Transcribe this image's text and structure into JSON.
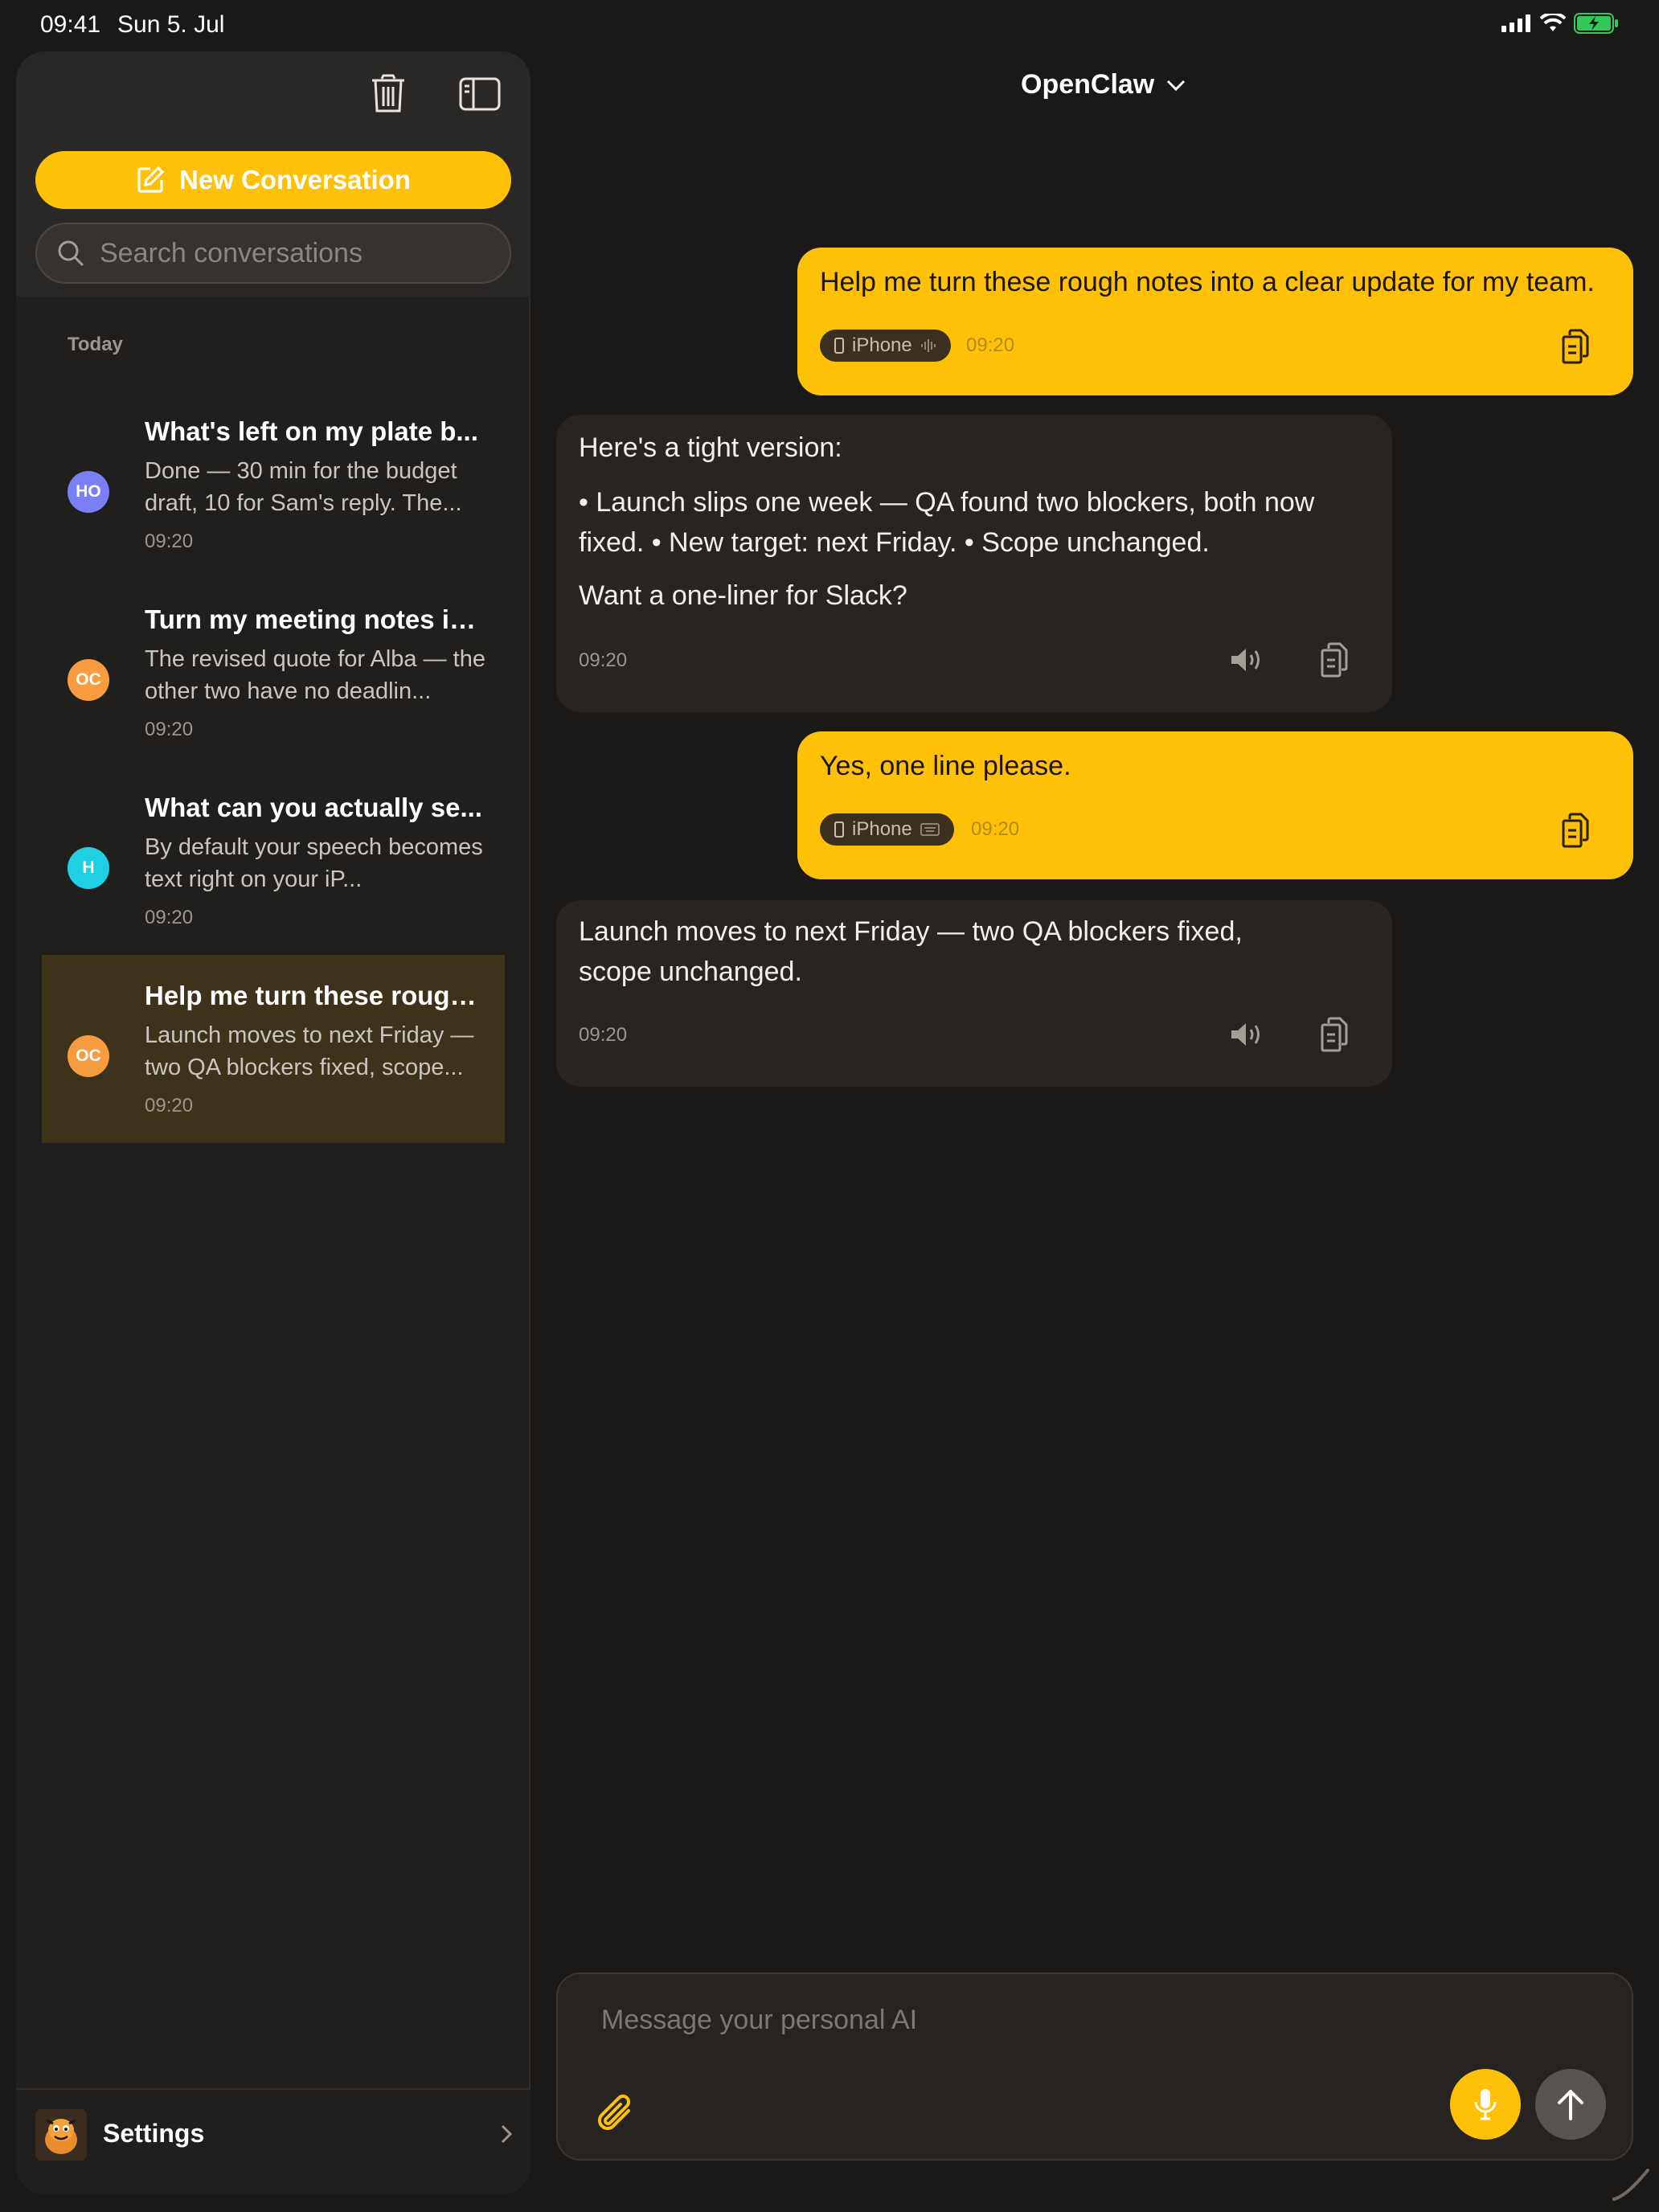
{
  "status_bar": {
    "time": "09:41",
    "date": "Sun 5. Jul"
  },
  "sidebar": {
    "new_conversation_label": "New Conversation",
    "search_placeholder": "Search conversations",
    "section_label": "Today",
    "conversations": [
      {
        "initials": "HO",
        "avatar_color": "#7b7ff5",
        "title": "What's left on my plate b...",
        "preview": "Done — 30 min for the budget draft, 10 for Sam's reply. The...",
        "time": "09:20",
        "active": false
      },
      {
        "initials": "OC",
        "avatar_color": "#f79c3f",
        "title": "Turn my meeting notes in...",
        "preview": "The revised quote for Alba — the other two have no deadlin...",
        "time": "09:20",
        "active": false
      },
      {
        "initials": "H",
        "avatar_color": "#1fcfe3",
        "title": "What can you actually se...",
        "preview": "By default your speech becomes text right on your iP...",
        "time": "09:20",
        "active": false
      },
      {
        "initials": "OC",
        "avatar_color": "#f79c3f",
        "title": "Help me turn these rough...",
        "preview": "Launch moves to next Friday — two QA blockers fixed, scope...",
        "time": "09:20",
        "active": true
      }
    ],
    "settings_label": "Settings"
  },
  "header": {
    "title": "OpenClaw"
  },
  "messages": [
    {
      "role": "user",
      "text": "Help me turn these rough notes into a clear update for my team.",
      "device": "iPhone",
      "input_mode": "voice",
      "time": "09:20"
    },
    {
      "role": "assistant",
      "paragraphs": [
        "Here's a tight version:",
        "• Launch slips one week — QA found two blockers, both now fixed. • New target: next Friday. • Scope unchanged.",
        "Want a one-liner for Slack?"
      ],
      "time": "09:20"
    },
    {
      "role": "user",
      "text": "Yes, one line please.",
      "device": "iPhone",
      "input_mode": "keyboard",
      "time": "09:20"
    },
    {
      "role": "assistant",
      "paragraphs": [
        "Launch moves to next Friday — two QA blockers fixed, scope unchanged."
      ],
      "time": "09:20"
    }
  ],
  "composer": {
    "placeholder": "Message your personal AI"
  },
  "colors": {
    "accent": "#ffc107",
    "background": "#1a1918",
    "bubble_ai": "#272422"
  }
}
